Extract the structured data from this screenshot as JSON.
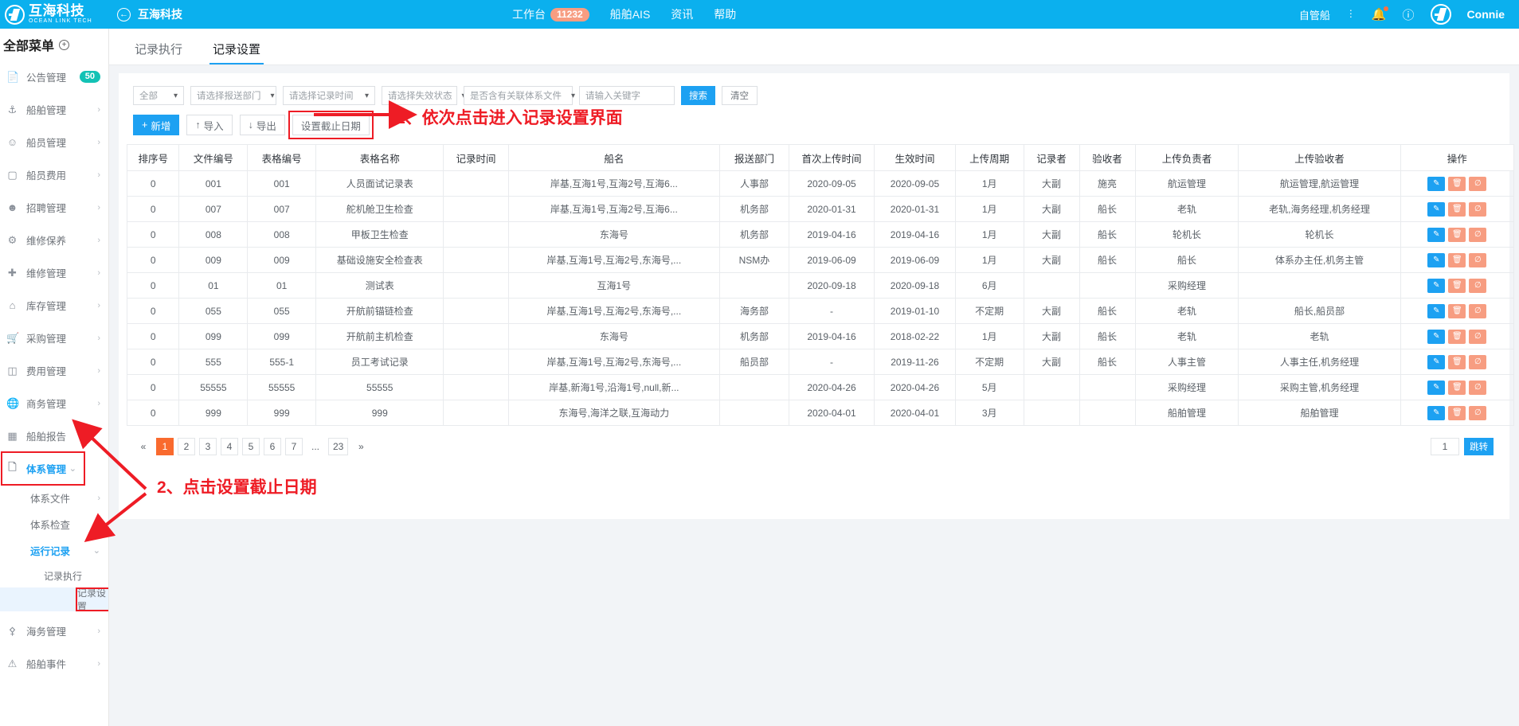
{
  "topbar": {
    "brand_cn": "互海科技",
    "brand_en": "OCEAN LINK TECH",
    "back_icon": "back-arrow-icon",
    "back_title": "互海科技",
    "nav": [
      {
        "label": "工作台",
        "badge": "11232"
      },
      {
        "label": "船舶AIS",
        "badge": ""
      },
      {
        "label": "资讯",
        "badge": ""
      },
      {
        "label": "帮助",
        "badge": ""
      }
    ],
    "right": {
      "ship_selector": "自管船",
      "more_icon": "dots-vertical-icon",
      "bell_icon": "bell-icon",
      "help_icon": "help-circle-icon",
      "avatar": "avatar-logo",
      "username": "Connie"
    }
  },
  "sidebar": {
    "title": "全部菜单",
    "add_icon": "plus-circle-icon",
    "items": [
      {
        "icon": "announcement-icon",
        "label": "公告管理",
        "badge": "50",
        "chevron": ""
      },
      {
        "icon": "anchor-icon",
        "label": "船舶管理",
        "badge": "",
        "chevron": "›"
      },
      {
        "icon": "user-icon",
        "label": "船员管理",
        "badge": "",
        "chevron": "›"
      },
      {
        "icon": "card-icon",
        "label": "船员费用",
        "badge": "",
        "chevron": "›"
      },
      {
        "icon": "recruit-icon",
        "label": "招聘管理",
        "badge": "",
        "chevron": "›"
      },
      {
        "icon": "wrench-icon",
        "label": "维修保养",
        "badge": "",
        "chevron": "›"
      },
      {
        "icon": "spanner-icon",
        "label": "维修管理",
        "badge": "",
        "chevron": "›"
      },
      {
        "icon": "warehouse-icon",
        "label": "库存管理",
        "badge": "",
        "chevron": "›"
      },
      {
        "icon": "cart-icon",
        "label": "采购管理",
        "badge": "",
        "chevron": "›"
      },
      {
        "icon": "database-icon",
        "label": "费用管理",
        "badge": "",
        "chevron": "›"
      },
      {
        "icon": "globe-icon",
        "label": "商务管理",
        "badge": "",
        "chevron": "›"
      },
      {
        "icon": "report-icon",
        "label": "船舶报告",
        "badge": "",
        "chevron": ""
      }
    ],
    "system_group": {
      "icon": "document-copy-icon",
      "label": "体系管理",
      "chevron": "⌄",
      "children": [
        {
          "label": "体系文件",
          "chevron": "›"
        },
        {
          "label": "体系检查",
          "chevron": "›"
        },
        {
          "label": "运行记录",
          "chevron": "⌄"
        }
      ],
      "records": [
        {
          "label": "记录执行",
          "selected": false
        },
        {
          "label": "记录设置",
          "selected": true
        }
      ]
    },
    "tail_items": [
      {
        "icon": "marine-icon",
        "label": "海务管理",
        "chevron": "›"
      },
      {
        "icon": "alert-icon",
        "label": "船舶事件",
        "chevron": "›"
      }
    ]
  },
  "tabs": [
    {
      "label": "记录执行",
      "active": false
    },
    {
      "label": "记录设置",
      "active": true
    }
  ],
  "filters": {
    "scope": "全部",
    "department": "请选择报送部门",
    "record_time": "请选择记录时间",
    "invalid_state": "请选择失效状态",
    "linked_file": "是否含有关联体系文件",
    "keyword_placeholder": "请输入关键字",
    "keyword_value": "",
    "search_label": "搜索",
    "clear_label": "清空",
    "chevron_icon": "chevron-down-icon"
  },
  "actions": {
    "add_label": "新增",
    "add_icon": "plus-icon",
    "import_label": "导入",
    "import_icon": "upload-icon",
    "export_label": "导出",
    "export_icon": "download-icon",
    "deadline_label": "设置截止日期"
  },
  "table": {
    "columns": [
      "排序号",
      "文件编号",
      "表格编号",
      "表格名称",
      "记录时间",
      "船名",
      "报送部门",
      "首次上传时间",
      "生效时间",
      "上传周期",
      "记录者",
      "验收者",
      "上传负责者",
      "上传验收者",
      "操作"
    ],
    "rows": [
      {
        "c": [
          "0",
          "001",
          "001",
          "人员面试记录表",
          "",
          "岸基,互海1号,互海2号,互海6...",
          "人事部",
          "2020-09-05",
          "2020-09-05",
          "1月",
          "大副",
          "施亮",
          "航运管理",
          "航运管理,航运管理"
        ]
      },
      {
        "c": [
          "0",
          "007",
          "007",
          "舵机舱卫生检查",
          "",
          "岸基,互海1号,互海2号,互海6...",
          "机务部",
          "2020-01-31",
          "2020-01-31",
          "1月",
          "大副",
          "船长",
          "老轨",
          "老轨,海务经理,机务经理"
        ]
      },
      {
        "c": [
          "0",
          "008",
          "008",
          "甲板卫生检查",
          "",
          "东海号",
          "机务部",
          "2019-04-16",
          "2019-04-16",
          "1月",
          "大副",
          "船长",
          "轮机长",
          "轮机长"
        ]
      },
      {
        "c": [
          "0",
          "009",
          "009",
          "基础设施安全检查表",
          "",
          "岸基,互海1号,互海2号,东海号,...",
          "NSM办",
          "2019-06-09",
          "2019-06-09",
          "1月",
          "大副",
          "船长",
          "船长",
          "体系办主任,机务主管"
        ]
      },
      {
        "c": [
          "0",
          "01",
          "01",
          "测试表",
          "",
          "互海1号",
          "",
          "2020-09-18",
          "2020-09-18",
          "6月",
          "",
          "",
          "采购经理",
          ""
        ]
      },
      {
        "c": [
          "0",
          "055",
          "055",
          "开航前锚链检查",
          "",
          "岸基,互海1号,互海2号,东海号,...",
          "海务部",
          "-",
          "2019-01-10",
          "不定期",
          "大副",
          "船长",
          "老轨",
          "船长,船员部"
        ]
      },
      {
        "c": [
          "0",
          "099",
          "099",
          "开航前主机检查",
          "",
          "东海号",
          "机务部",
          "2019-04-16",
          "2018-02-22",
          "1月",
          "大副",
          "船长",
          "老轨",
          "老轨"
        ]
      },
      {
        "c": [
          "0",
          "555",
          "555-1",
          "员工考试记录",
          "",
          "岸基,互海1号,互海2号,东海号,...",
          "船员部",
          "-",
          "2019-11-26",
          "不定期",
          "大副",
          "船长",
          "人事主管",
          "人事主任,机务经理"
        ]
      },
      {
        "c": [
          "0",
          "55555",
          "55555",
          "55555",
          "",
          "岸基,新海1号,沿海1号,null,新...",
          "",
          "2020-04-26",
          "2020-04-26",
          "5月",
          "",
          "",
          "采购经理",
          "采购主管,机务经理"
        ]
      },
      {
        "c": [
          "0",
          "999",
          "999",
          "999",
          "",
          "东海号,海洋之联,互海动力",
          "",
          "2020-04-01",
          "2020-04-01",
          "3月",
          "",
          "",
          "船舶管理",
          "船舶管理"
        ]
      }
    ],
    "ops": {
      "edit_icon": "pencil-icon",
      "delete_icon": "trash-icon",
      "disable_icon": "ban-icon"
    }
  },
  "pagination": {
    "prev": "«",
    "pages": [
      "1",
      "2",
      "3",
      "4",
      "5",
      "6",
      "7",
      "...",
      "23"
    ],
    "next": "»",
    "current": "1",
    "jump_value": "1",
    "jump_label": "跳转"
  },
  "annotations": [
    {
      "text": "2、点击设置截止日期"
    },
    {
      "text": "1、依次点击进入记录设置界面"
    }
  ],
  "colors": {
    "brand_blue": "#0bb0ee",
    "accent_blue": "#1da1f2",
    "annotation_red": "#ee1c25",
    "page_current_orange": "#f96a2e",
    "badge_teal": "#13c2b5",
    "badge_salmon": "#f79d81"
  }
}
